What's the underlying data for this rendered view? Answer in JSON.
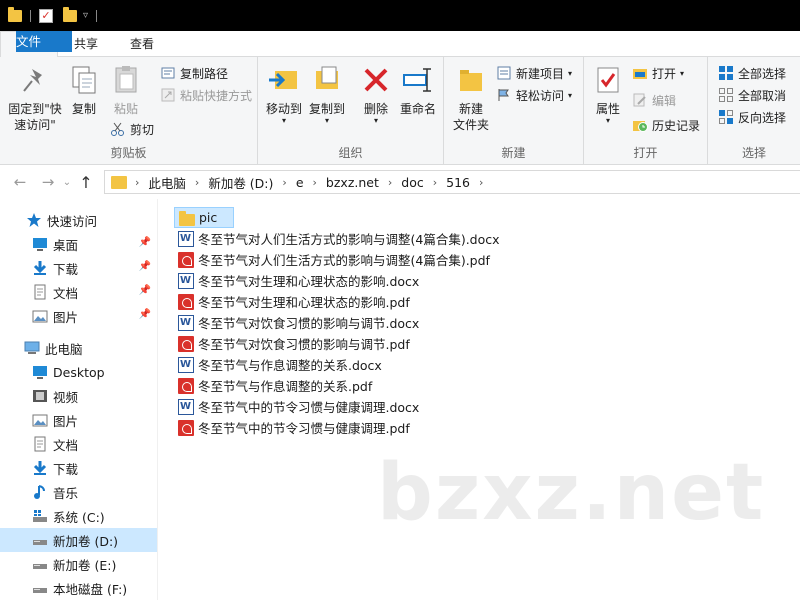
{
  "tabs": [
    {
      "label": "文件"
    },
    {
      "label": "主页"
    },
    {
      "label": "共享"
    },
    {
      "label": "查看"
    }
  ],
  "ribbon": {
    "clipboard": {
      "label": "剪贴板",
      "pin_line1": "固定到\"快",
      "pin_line2": "速访问\"",
      "copy": "复制",
      "paste": "粘贴",
      "copy_path": "复制路径",
      "paste_shortcut": "粘贴快捷方式",
      "cut": "剪切"
    },
    "organize": {
      "label": "组织",
      "move_to": "移动到",
      "copy_to": "复制到",
      "delete": "删除",
      "rename": "重命名"
    },
    "new": {
      "label": "新建",
      "new_folder_line1": "新建",
      "new_folder_line2": "文件夹",
      "new_item": "新建项目",
      "easy_access": "轻松访问"
    },
    "open": {
      "label": "打开",
      "properties": "属性",
      "open": "打开",
      "edit": "编辑",
      "history": "历史记录"
    },
    "select": {
      "label": "选择",
      "select_all": "全部选择",
      "select_none": "全部取消",
      "invert": "反向选择"
    }
  },
  "address": {
    "crumbs": [
      "此电脑",
      "新加卷 (D:)",
      "e",
      "bzxz.net",
      "doc",
      "516"
    ]
  },
  "nav": {
    "quick_access": "快速访问",
    "quick_items": [
      "桌面",
      "下载",
      "文档",
      "图片"
    ],
    "this_pc": "此电脑",
    "pc_items": [
      "Desktop",
      "视频",
      "图片",
      "文档",
      "下载",
      "音乐",
      "系统 (C:)",
      "新加卷 (D:)",
      "新加卷 (E:)",
      "本地磁盘 (F:)"
    ]
  },
  "files": [
    {
      "name": "pic",
      "type": "folder"
    },
    {
      "name": "冬至节气对人们生活方式的影响与调整(4篇合集).docx",
      "type": "docx"
    },
    {
      "name": "冬至节气对人们生活方式的影响与调整(4篇合集).pdf",
      "type": "pdf"
    },
    {
      "name": "冬至节气对生理和心理状态的影响.docx",
      "type": "docx"
    },
    {
      "name": "冬至节气对生理和心理状态的影响.pdf",
      "type": "pdf"
    },
    {
      "name": "冬至节气对饮食习惯的影响与调节.docx",
      "type": "docx"
    },
    {
      "name": "冬至节气对饮食习惯的影响与调节.pdf",
      "type": "pdf"
    },
    {
      "name": "冬至节气与作息调整的关系.docx",
      "type": "docx"
    },
    {
      "name": "冬至节气与作息调整的关系.pdf",
      "type": "pdf"
    },
    {
      "name": "冬至节气中的节令习惯与健康调理.docx",
      "type": "docx"
    },
    {
      "name": "冬至节气中的节令习惯与健康调理.pdf",
      "type": "pdf"
    }
  ],
  "watermark": "bzxz.net",
  "colors": {
    "accent": "#1979ca",
    "selection": "#cce8ff",
    "folder": "#f3c443",
    "pdf": "#d9312b",
    "word": "#2b579a"
  }
}
